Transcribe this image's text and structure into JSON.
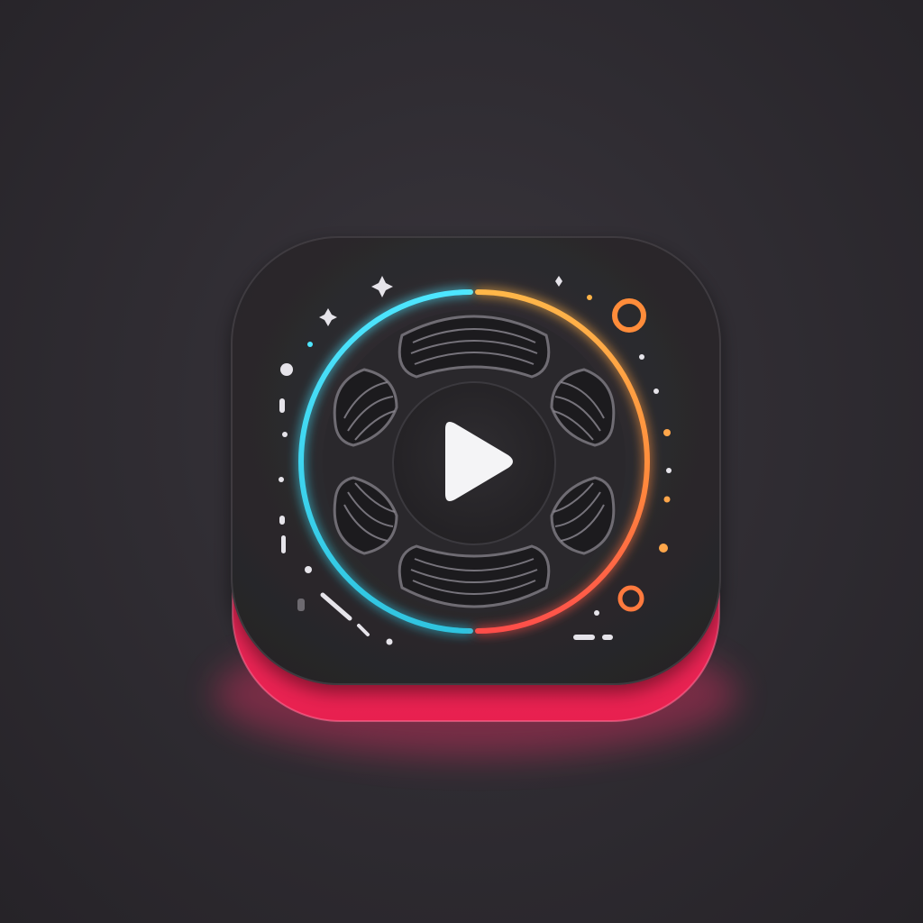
{
  "scene": {
    "background_color": "#302d33",
    "icon": {
      "semantic": "video-reel-play-app-icon",
      "face_color": "#2c2a2e",
      "base_glow_color": "#ff2d6b",
      "ring_colors": {
        "left": "#35d6f0",
        "right_top": "#ffb347",
        "right_bottom": "#ff5a4a"
      },
      "center_symbol": "play-icon",
      "play_color": "#f4f4f6",
      "reel_hole_count": 6
    }
  }
}
